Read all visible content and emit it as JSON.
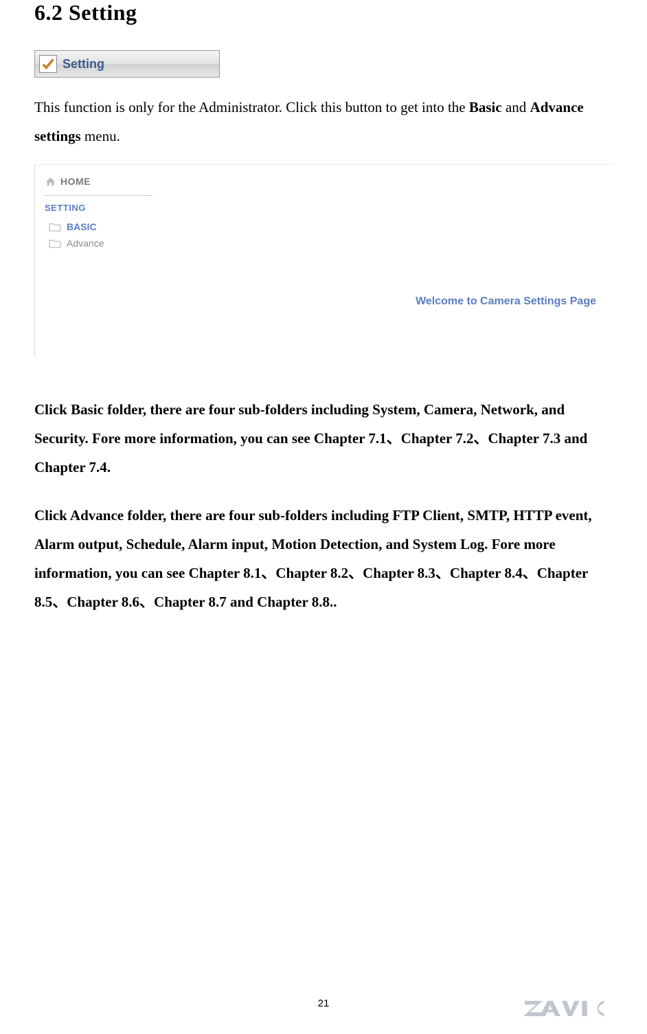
{
  "heading": "6.2 Setting",
  "setting_button": {
    "label": "Setting"
  },
  "intro": {
    "part1": "This function is only for the Administrator. Click this button to get into the ",
    "bold1": "Basic",
    "part2": " and ",
    "bold2": "Advance settings",
    "part3": " menu."
  },
  "settings_page": {
    "home": "HOME",
    "section": "SETTING",
    "nav": {
      "basic": "BASIC",
      "advance": "Advance"
    },
    "welcome": "Welcome to Camera Settings Page"
  },
  "para_basic": "Click Basic folder, there are four sub-folders including System, Camera, Network, and Security. Fore more information, you can see Chapter 7.1、Chapter 7.2、Chapter 7.3 and Chapter 7.4.",
  "para_advance": "Click Advance folder, there are four sub-folders including FTP Client, SMTP, HTTP event, Alarm output, Schedule, Alarm input, Motion Detection, and System Log. Fore more information, you can see Chapter 8.1、Chapter 8.2、Chapter 8.3、Chapter 8.4、Chapter 8.5、Chapter 8.6、Chapter 8.7 and Chapter 8.8..",
  "page_number": "21",
  "brand": "ZAVIO"
}
